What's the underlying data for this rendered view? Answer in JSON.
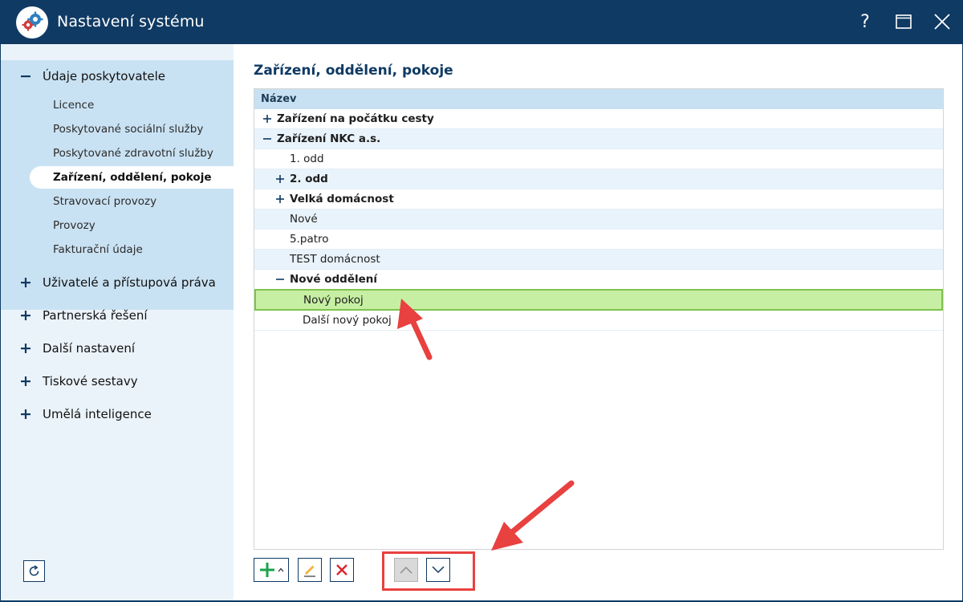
{
  "window": {
    "title": "Nastavení systému",
    "help_label": "?"
  },
  "sidebar": {
    "expanded_group": {
      "label": "Údaje poskytovatele",
      "items": [
        {
          "label": "Licence"
        },
        {
          "label": "Poskytované sociální služby"
        },
        {
          "label": "Poskytované zdravotní služby"
        },
        {
          "label": "Zařízení, oddělení, pokoje",
          "active": true
        },
        {
          "label": "Stravovací provozy"
        },
        {
          "label": "Provozy"
        },
        {
          "label": "Fakturační údaje"
        }
      ]
    },
    "groups": [
      {
        "label": "Uživatelé a přístupová práva"
      },
      {
        "label": "Partnerská řešení"
      },
      {
        "label": "Další nastavení"
      },
      {
        "label": "Tiskové sestavy"
      },
      {
        "label": "Umělá inteligence"
      }
    ]
  },
  "main": {
    "title": "Zařízení, oddělení, pokoje",
    "grid": {
      "column_header": "Název",
      "rows": [
        {
          "label": "Zařízení na počátku cesty",
          "toggle": "+",
          "bold": true
        },
        {
          "label": "Zařízení NKC a.s.",
          "toggle": "-",
          "bold": true
        },
        {
          "label": "1. odd",
          "toggle": "",
          "bold": false
        },
        {
          "label": "2. odd",
          "toggle": "+",
          "bold": true
        },
        {
          "label": "Velká domácnost",
          "toggle": "+",
          "bold": true
        },
        {
          "label": "Nové",
          "toggle": "",
          "bold": false
        },
        {
          "label": "5.patro",
          "toggle": "",
          "bold": false
        },
        {
          "label": "TEST domácnost",
          "toggle": "",
          "bold": false
        },
        {
          "label": "Nové oddělení",
          "toggle": "-",
          "bold": true
        },
        {
          "label": "Nový pokoj",
          "toggle": "",
          "bold": false,
          "selected": true
        },
        {
          "label": "Další nový pokoj",
          "toggle": "",
          "bold": false
        }
      ]
    }
  },
  "colors": {
    "titlebar": "#0f3a63",
    "sidebar_bg": "#ebf3fa",
    "sidebar_expanded_bg": "#c9e2f3",
    "grid_header_bg": "#c8e1f2",
    "selected_row_bg": "#c7efa3",
    "annotation": "#e8413f"
  }
}
